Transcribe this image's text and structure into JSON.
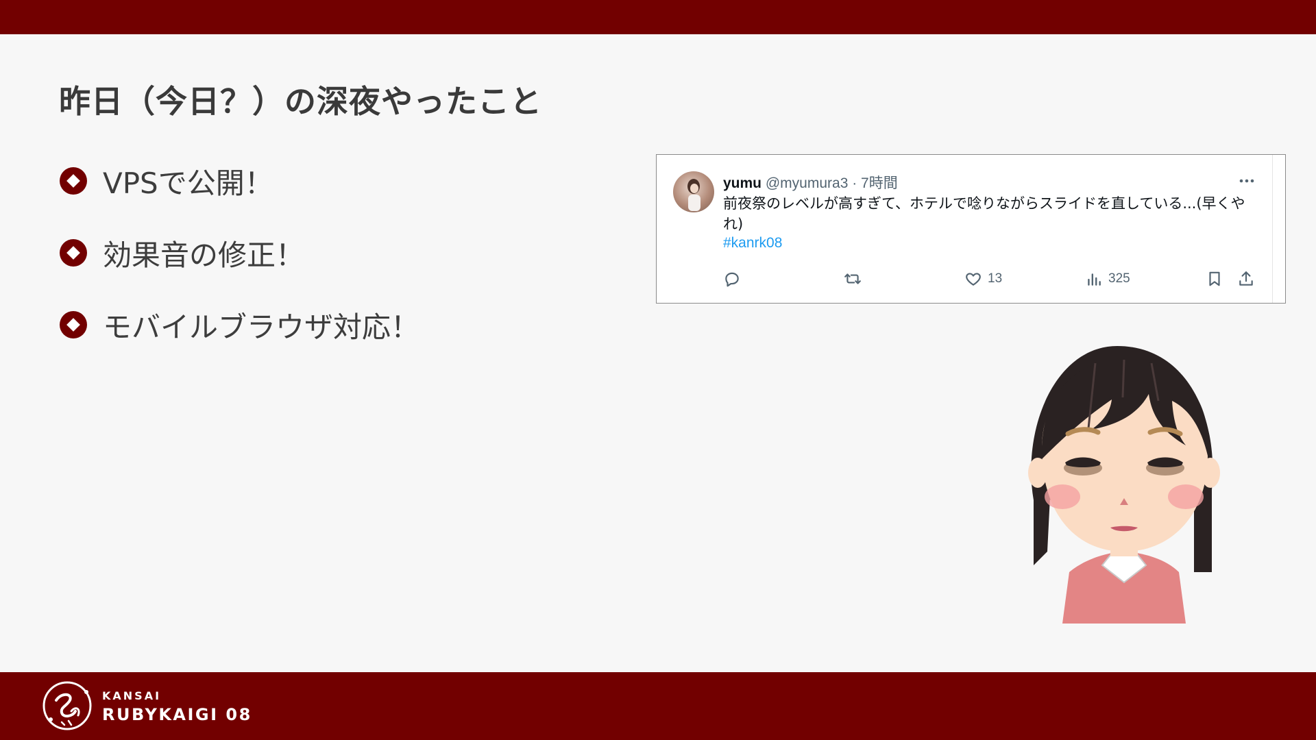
{
  "slide": {
    "title": "昨日（今日？）の深夜やったこと",
    "bullets": [
      {
        "text": "VPSで公開！"
      },
      {
        "text": "効果音の修正！"
      },
      {
        "text": "モバイルブラウザ対応！"
      }
    ]
  },
  "tweet": {
    "name": "yumu",
    "handle": "@myumura3 · 7時間",
    "body": "前夜祭のレベルが高すぎて、ホテルで唸りながらスライドを直している...(早くやれ)",
    "hashtag": "#kanrk08",
    "likes": "13",
    "views": "325",
    "icons": [
      "reply-icon",
      "retweet-icon",
      "like-icon",
      "views-icon",
      "bookmark-icon",
      "share-icon",
      "more-icon"
    ]
  },
  "footer": {
    "brand_small": "KANSAI",
    "brand_big": "RUBYKAIGI 08"
  },
  "colors": {
    "brand": "#720000",
    "background": "#f7f7f7",
    "hashtag": "#1d9bf0"
  }
}
